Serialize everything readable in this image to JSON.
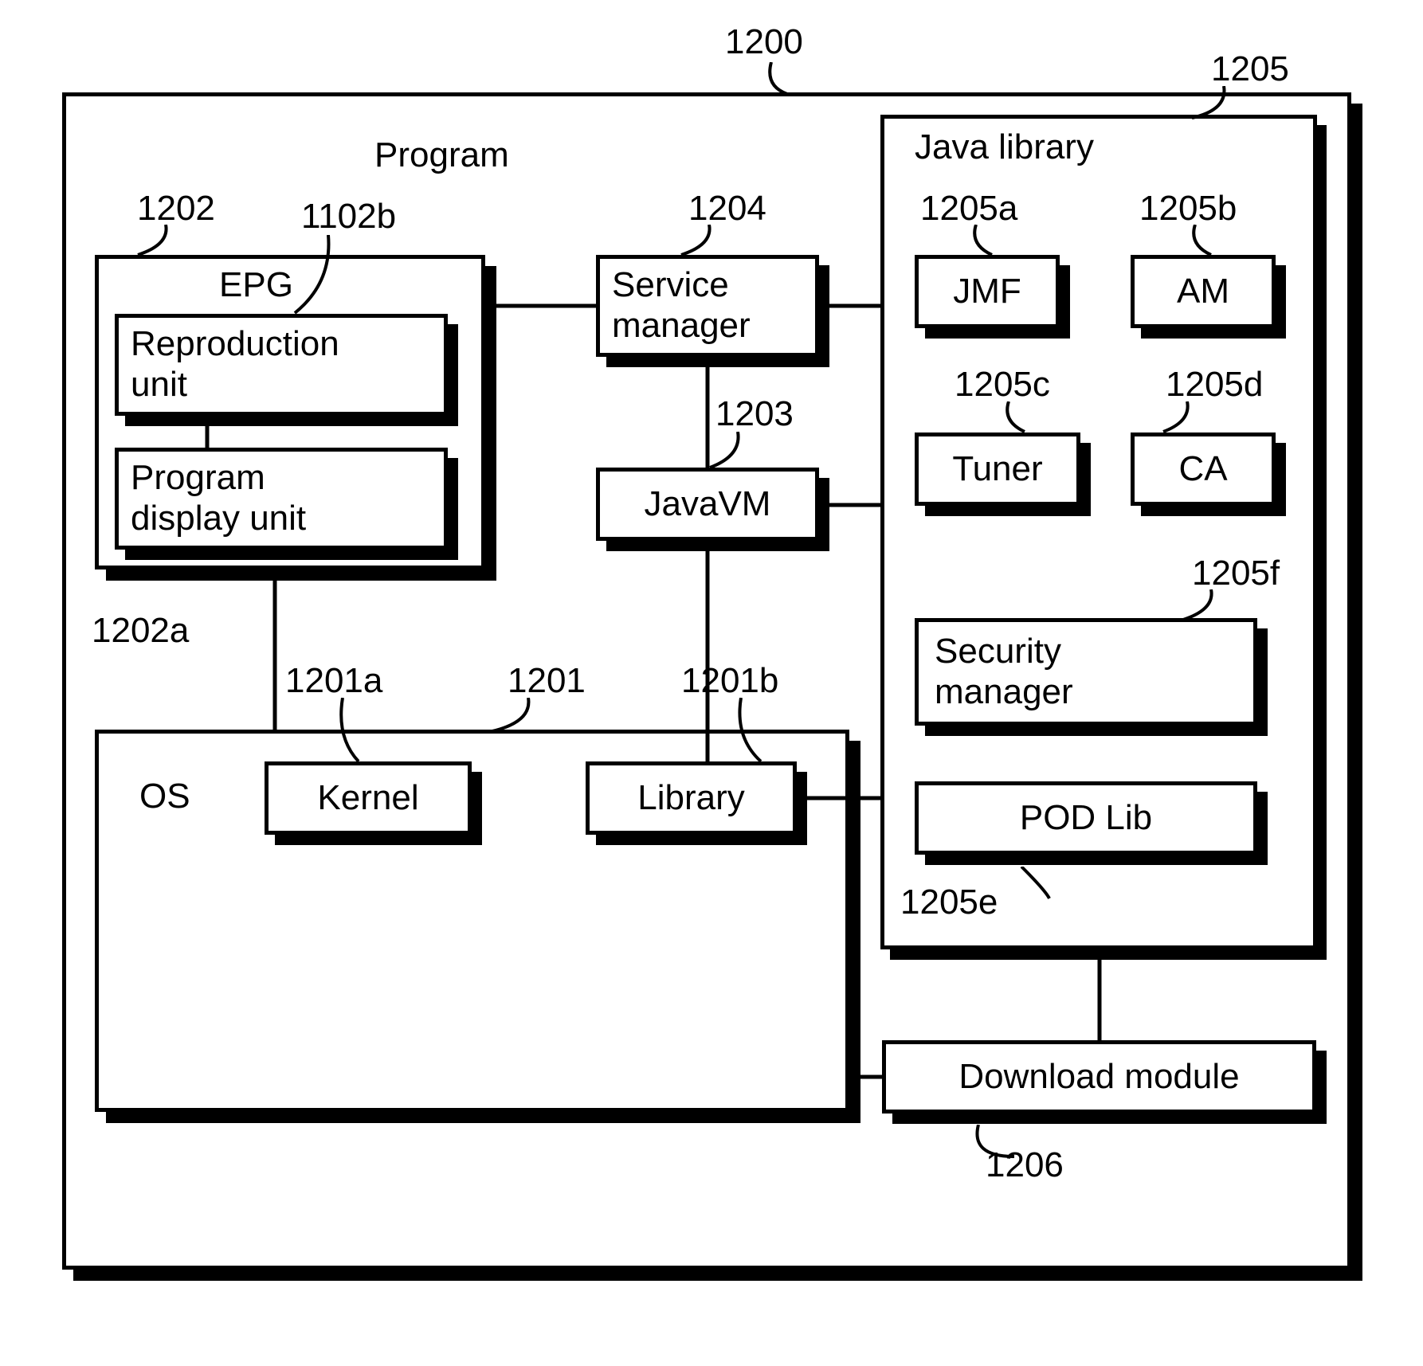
{
  "title": "Program",
  "refs": {
    "program": "1200",
    "epg": "1202",
    "epg_repro": "1102b",
    "program_display": "1202a",
    "service_mgr": "1204",
    "javavm": "1203",
    "os": "1201",
    "kernel": "1201a",
    "library": "1201b",
    "java_lib": "1205",
    "jmf": "1205a",
    "am": "1205b",
    "tuner": "1205c",
    "ca": "1205d",
    "pod_lib": "1205e",
    "security_mgr": "1205f",
    "download": "1206"
  },
  "boxes": {
    "epg": "EPG",
    "reproduction": "Reproduction\nunit",
    "program_display": "Program\ndisplay unit",
    "service_mgr": "Service\nmanager",
    "javavm": "JavaVM",
    "os": "OS",
    "kernel": "Kernel",
    "library": "Library",
    "java_lib": "Java library",
    "jmf": "JMF",
    "am": "AM",
    "tuner": "Tuner",
    "ca": "CA",
    "security_mgr": "Security\nmanager",
    "pod_lib": "POD Lib",
    "download": "Download module"
  }
}
